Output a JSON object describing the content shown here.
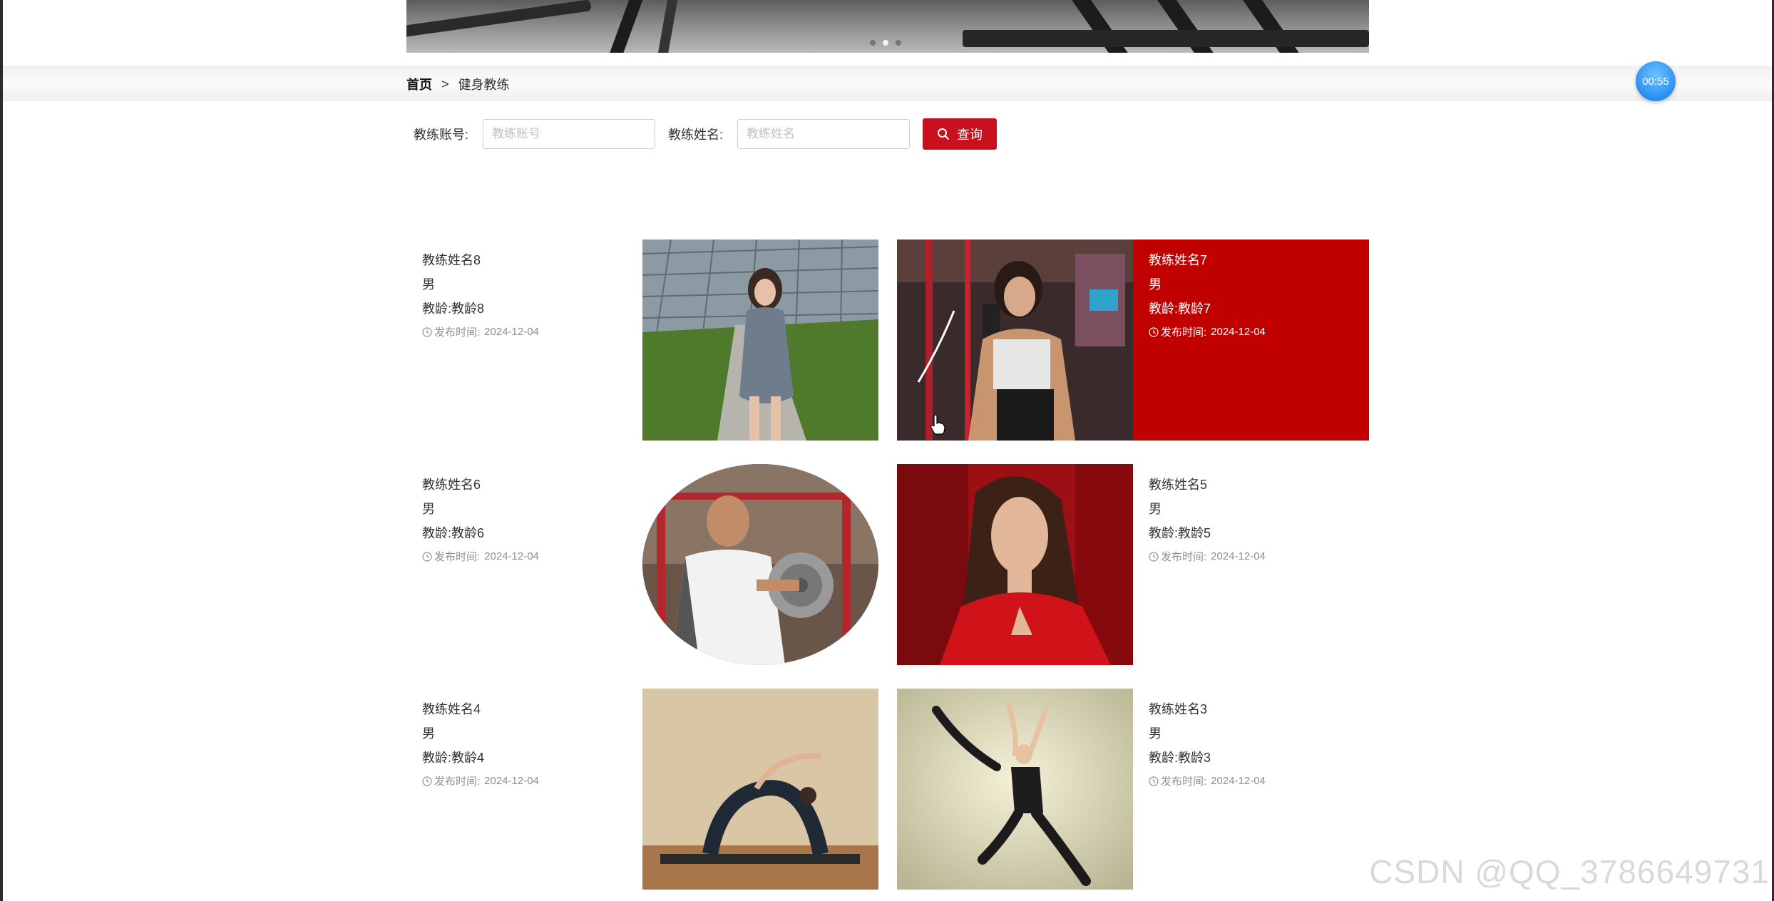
{
  "timer": "00:55",
  "breadcrumb": {
    "home": "首页",
    "separator": ">",
    "current": "健身教练"
  },
  "search": {
    "account_label": "教练账号:",
    "account_placeholder": "教练账号",
    "account_value": "",
    "name_label": "教练姓名:",
    "name_placeholder": "教练姓名",
    "name_value": "",
    "button_label": "查询",
    "button_color": "#c8101e"
  },
  "cards": [
    {
      "name": "教练姓名8",
      "gender": "男",
      "age": "教龄:教龄8",
      "publish_label": "发布时间:",
      "publish_date": "2024-12-04",
      "photo": "woman-in-plaid-dress-outdoors"
    },
    {
      "name": "教练姓名7",
      "gender": "男",
      "age": "教龄:教龄7",
      "publish_label": "发布时间:",
      "publish_date": "2024-12-04",
      "photo": "muscular-woman-gym-selfie",
      "highlighted": true
    },
    {
      "name": "教练姓名6",
      "gender": "男",
      "age": "教龄:教龄6",
      "publish_label": "发布时间:",
      "publish_date": "2024-12-04",
      "photo": "man-lifting-dumbbell"
    },
    {
      "name": "教练姓名5",
      "gender": "男",
      "age": "教龄:教龄5",
      "publish_label": "发布时间:",
      "publish_date": "2024-12-04",
      "photo": "woman-in-red-dress"
    },
    {
      "name": "教练姓名4",
      "gender": "男",
      "age": "教龄:教龄4",
      "publish_label": "发布时间:",
      "publish_date": "2024-12-04",
      "photo": "yoga-backbend-pose"
    },
    {
      "name": "教练姓名3",
      "gender": "男",
      "age": "教龄:教龄3",
      "publish_label": "发布时间:",
      "publish_date": "2024-12-04",
      "photo": "ballet-dancer-leap"
    }
  ],
  "highlight_color": "#c10000",
  "watermark": "CSDN @QQ_3786649731"
}
